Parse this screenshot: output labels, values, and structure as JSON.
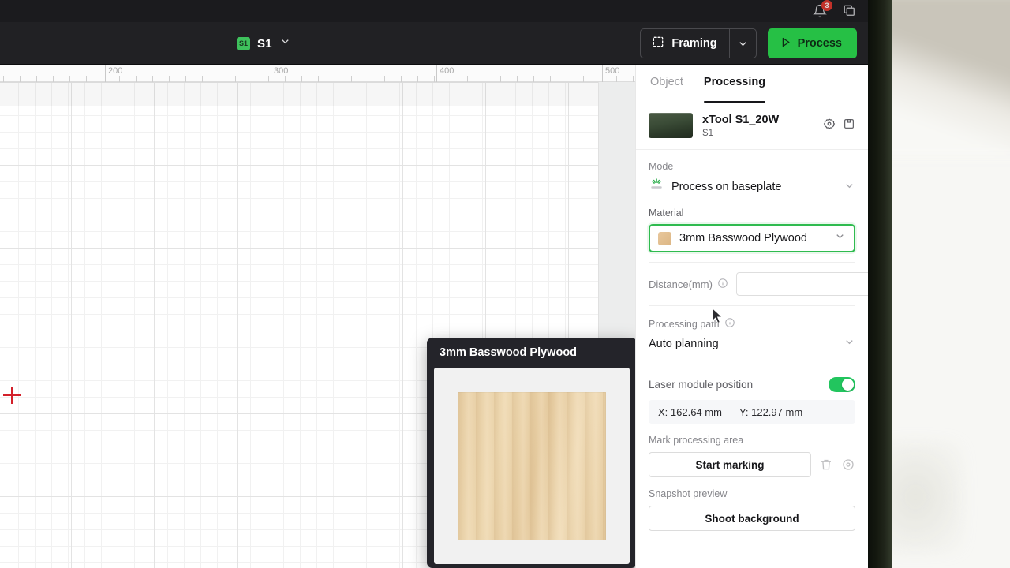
{
  "titlebar": {
    "notification_icon": "bell-icon",
    "notification_count": "3",
    "layers_icon": "layers-icon"
  },
  "toolbar": {
    "device_badge": "S1",
    "device_name": "S1",
    "device_caret_icon": "chevron-down-icon",
    "framing_label": "Framing",
    "framing_icon": "dashed-square-icon",
    "framing_caret_icon": "chevron-down-icon",
    "process_label": "Process",
    "process_icon": "play-icon",
    "process_color": "#26c045"
  },
  "canvas": {
    "ruler_labels": [
      "200",
      "300",
      "400",
      "500"
    ],
    "crosshair_color": "#d3202a"
  },
  "material_card": {
    "title": "3mm Basswood Plywood",
    "swatch_color": "#e8cfa4"
  },
  "panel": {
    "tabs": [
      {
        "label": "Object",
        "active": false
      },
      {
        "label": "Processing",
        "active": true
      }
    ],
    "device": {
      "title": "xTool S1_20W",
      "subtitle": "S1",
      "settings_icon": "gear-icon",
      "save_icon": "save-card-icon"
    },
    "mode": {
      "label": "Mode",
      "value": "Process on baseplate",
      "icon": "laser-baseplate-icon",
      "caret_icon": "chevron-down-icon"
    },
    "material": {
      "label": "Material",
      "value": "3mm Basswood Plywood",
      "chip_color": "#e8c79c",
      "caret_icon": "chevron-down-icon",
      "focus_color": "#2fbb4f"
    },
    "distance": {
      "label": "Distance(mm)",
      "info_icon": "info-icon",
      "value": "",
      "placeholder": "",
      "target_icon": "crosshair-target-icon"
    },
    "processing_path": {
      "label": "Processing path",
      "info_icon": "info-icon",
      "value": "Auto planning",
      "caret_icon": "chevron-down-icon"
    },
    "laser_module": {
      "label": "Laser module position",
      "toggle_on": true,
      "toggle_color": "#22c55e",
      "x_value": "X: 162.64 mm",
      "y_value": "Y: 122.97 mm"
    },
    "mark_area": {
      "label": "Mark processing area",
      "button_label": "Start marking",
      "delete_icon": "trash-icon",
      "preview_icon": "eye-icon"
    },
    "snapshot": {
      "label": "Snapshot preview",
      "button_label": "Shoot background"
    }
  }
}
